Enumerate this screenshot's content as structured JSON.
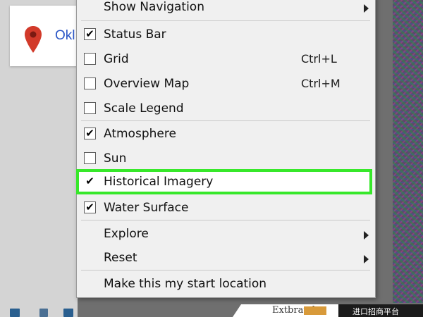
{
  "search": {
    "text": "Okl"
  },
  "menu": {
    "items": [
      {
        "label": "Show Navigation",
        "checkbox": false,
        "checked": false,
        "shortcut": "",
        "submenu": true
      },
      {
        "label": "Status Bar",
        "checkbox": true,
        "checked": true,
        "shortcut": "",
        "submenu": false
      },
      {
        "label": "Grid",
        "checkbox": true,
        "checked": false,
        "shortcut": "Ctrl+L",
        "submenu": false
      },
      {
        "label": "Overview Map",
        "checkbox": true,
        "checked": false,
        "shortcut": "Ctrl+M",
        "submenu": false
      },
      {
        "label": "Scale Legend",
        "checkbox": true,
        "checked": false,
        "shortcut": "",
        "submenu": false
      },
      {
        "label": "Atmosphere",
        "checkbox": true,
        "checked": true,
        "shortcut": "",
        "submenu": false
      },
      {
        "label": "Sun",
        "checkbox": true,
        "checked": false,
        "shortcut": "",
        "submenu": false
      },
      {
        "label": "Historical Imagery",
        "checkbox": true,
        "checked": true,
        "shortcut": "",
        "submenu": false,
        "highlighted": true
      },
      {
        "label": "Water Surface",
        "checkbox": true,
        "checked": true,
        "shortcut": "",
        "submenu": false
      },
      {
        "label": "Explore",
        "checkbox": false,
        "checked": false,
        "shortcut": "",
        "submenu": true
      },
      {
        "label": "Reset",
        "checkbox": false,
        "checked": false,
        "shortcut": "",
        "submenu": true
      },
      {
        "label": "Make this my start location",
        "checkbox": false,
        "checked": false,
        "shortcut": "",
        "submenu": false
      }
    ],
    "check_mark": "✔"
  },
  "watermark": {
    "brand": "Extbrand",
    "slogan": "进口招商平台"
  },
  "colors": {
    "highlight_border": "#37e82a",
    "pin": "#d23a2a",
    "link_text": "#2a56c6"
  }
}
